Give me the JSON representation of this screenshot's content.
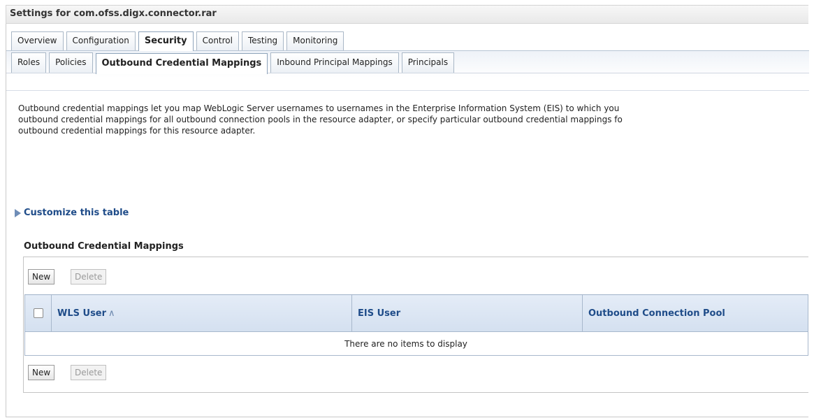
{
  "page": {
    "title": "Settings for com.ofss.digx.connector.rar"
  },
  "main_tabs": [
    {
      "label": "Overview",
      "active": false
    },
    {
      "label": "Configuration",
      "active": false
    },
    {
      "label": "Security",
      "active": true
    },
    {
      "label": "Control",
      "active": false
    },
    {
      "label": "Testing",
      "active": false
    },
    {
      "label": "Monitoring",
      "active": false
    }
  ],
  "sub_tabs": [
    {
      "label": "Roles",
      "active": false
    },
    {
      "label": "Policies",
      "active": false
    },
    {
      "label": "Outbound Credential Mappings",
      "active": true
    },
    {
      "label": "Inbound Principal Mappings",
      "active": false
    },
    {
      "label": "Principals",
      "active": false
    }
  ],
  "description": {
    "line1": "Outbound credential mappings let you map WebLogic Server usernames to usernames in the Enterprise Information System (EIS) to which you",
    "line2": "outbound credential mappings for all outbound connection pools in the resource adapter, or specify particular outbound credential mappings fo",
    "line3": "outbound credential mappings for this resource adapter."
  },
  "customize": {
    "label": "Customize this table",
    "icon": "expand-triangle-icon"
  },
  "table": {
    "title": "Outbound Credential Mappings",
    "buttons": {
      "new_label": "New",
      "delete_label": "Delete"
    },
    "columns": [
      "WLS User",
      "EIS User",
      "Outbound Connection Pool"
    ],
    "sort_icon": "sort-ascending-icon",
    "empty_message": "There are no items to display"
  },
  "colors": {
    "link": "#1f4c89",
    "header_bg": "#dce6f3",
    "border": "#a8b8cc"
  }
}
